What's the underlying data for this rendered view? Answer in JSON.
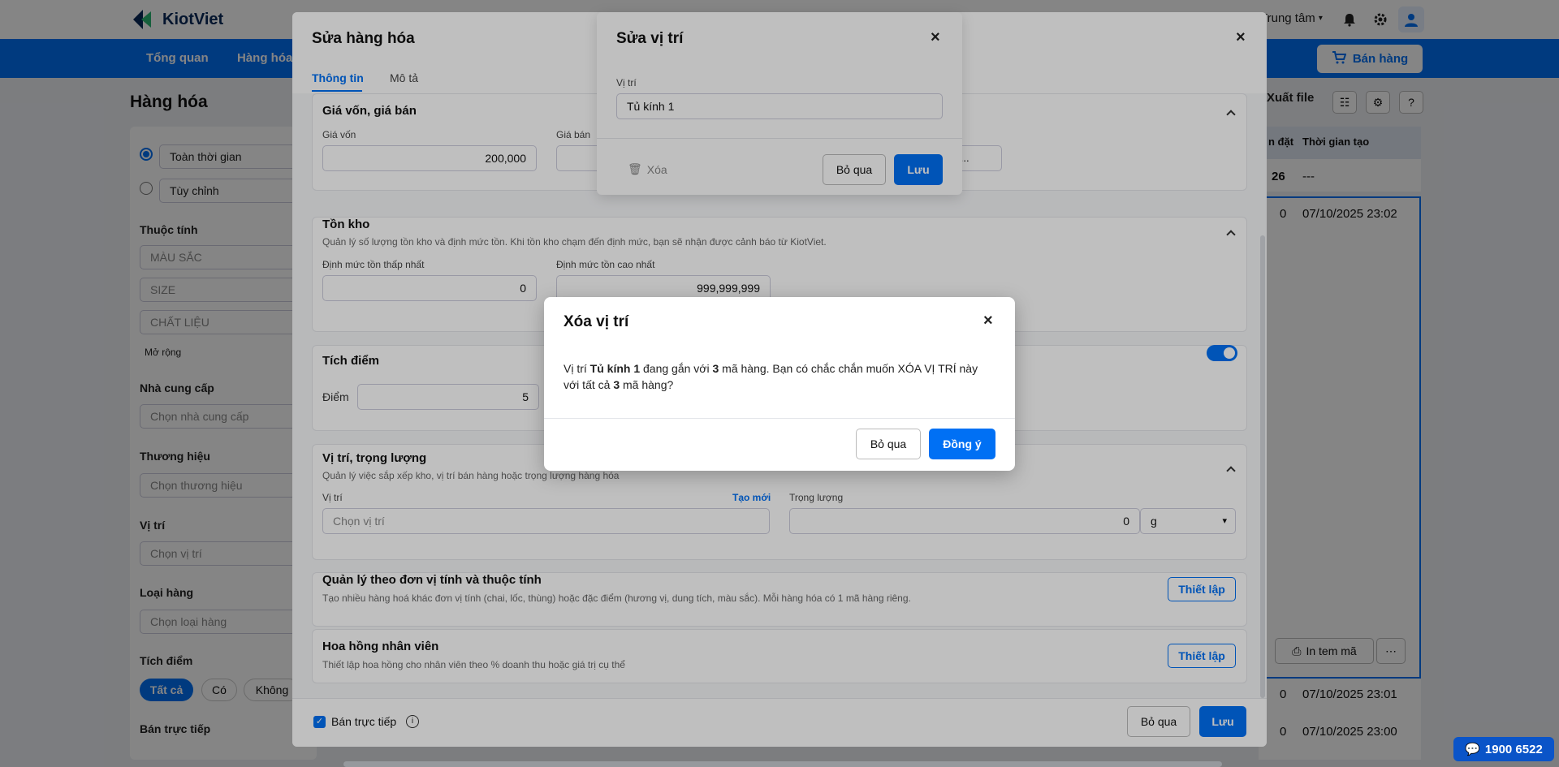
{
  "app": {
    "brand": "KiotViet",
    "branch": "Trung tâm"
  },
  "nav": {
    "items": [
      "Tổng quan",
      "Hàng hóa"
    ],
    "sell": "Bán hàng"
  },
  "toolbar": {
    "export": "Xuất file"
  },
  "page": {
    "title": "Hàng hóa"
  },
  "sidebar": {
    "time_all": "Toàn thời gian",
    "time_custom": "Tùy chỉnh",
    "attr_title": "Thuộc tính",
    "attr_color": "MÀU SẮC",
    "attr_size": "SIZE",
    "attr_material": "CHẤT LIỆU",
    "more": "Mở rộng",
    "supplier_title": "Nhà cung cấp",
    "supplier_ph": "Chọn nhà cung cấp",
    "brand_title": "Thương hiệu",
    "brand_ph": "Chọn thương hiệu",
    "location_title": "Vị trí",
    "location_ph": "Chọn vị trí",
    "type_title": "Loại hàng",
    "type_ph": "Chọn loại hàng",
    "points_title": "Tích điểm",
    "points_all": "Tất cả",
    "points_yes": "Có",
    "points_no": "Không",
    "direct_title": "Bán trực tiếp"
  },
  "table": {
    "col1": "n đặt",
    "col2": "Thời gian tạo",
    "rows": [
      [
        "26",
        "---"
      ],
      [
        "0",
        "07/10/2025 23:02"
      ],
      [
        "0",
        "07/10/2025 23:01"
      ],
      [
        "0",
        "07/10/2025 23:00"
      ]
    ],
    "print_label": "In tem mã"
  },
  "edit_modal": {
    "title": "Sửa hàng hóa",
    "tabs": [
      "Thông tin",
      "Mô tả"
    ],
    "price": {
      "title": "Giá vốn, giá bán",
      "cost_label": "Giá vốn",
      "cost_value": "200,000",
      "sale_label": "Giá bán",
      "select_value": "ối,..."
    },
    "stock": {
      "title": "Tồn kho",
      "desc": "Quản lý số lượng tồn kho và định mức tồn. Khi tồn kho chạm đến định mức, bạn sẽ nhận được cảnh báo từ KiotViet.",
      "min_label": "Định mức tồn thấp nhất",
      "min_value": "0",
      "max_label": "Định mức tồn cao nhất",
      "max_value": "999,999,999"
    },
    "points": {
      "title": "Tích điểm",
      "label": "Điểm",
      "value": "5"
    },
    "location": {
      "title": "Vị trí, trọng lượng",
      "desc": "Quản lý việc sắp xếp kho, vị trí bán hàng hoặc trọng lượng hàng hóa",
      "loc_label": "Vị trí",
      "create": "Tạo mới",
      "loc_ph": "Chọn vị trí",
      "weight_label": "Trọng lượng",
      "weight_value": "0",
      "unit": "g"
    },
    "units": {
      "title": "Quản lý theo đơn vị tính và thuộc tính",
      "desc": "Tạo nhiều hàng hoá khác đơn vị tính (chai, lốc, thùng) hoặc đặc điểm (hương vị, dung tích, màu sắc). Mỗi hàng hóa có 1 mã hàng riêng.",
      "btn": "Thiết lập"
    },
    "commission": {
      "title": "Hoa hồng nhân viên",
      "desc": "Thiết lập hoa hồng cho nhân viên theo % doanh thu hoặc giá trị cụ thể",
      "btn": "Thiết lập"
    },
    "footer": {
      "direct": "Bán trực tiếp",
      "cancel": "Bỏ qua",
      "save": "Lưu"
    }
  },
  "location_modal": {
    "title": "Sửa vị trí",
    "label": "Vị trí",
    "value": "Tủ kính 1",
    "delete": "Xóa",
    "cancel": "Bỏ qua",
    "save": "Lưu"
  },
  "delete_modal": {
    "title": "Xóa vị trí",
    "msg_1": "Vị trí ",
    "msg_loc": "Tủ kính 1",
    "msg_2": " đang gắn với ",
    "msg_n1": "3",
    "msg_3": " mã hàng. Bạn có chắc chắn muốn XÓA VỊ TRÍ này với tất cả ",
    "msg_n2": "3",
    "msg_4": " mã hàng?",
    "cancel": "Bỏ qua",
    "confirm": "Đồng ý"
  },
  "support": {
    "phone": "1900 6522"
  },
  "colors": {
    "primary": "#0070f4",
    "nav": "#0070f4"
  }
}
